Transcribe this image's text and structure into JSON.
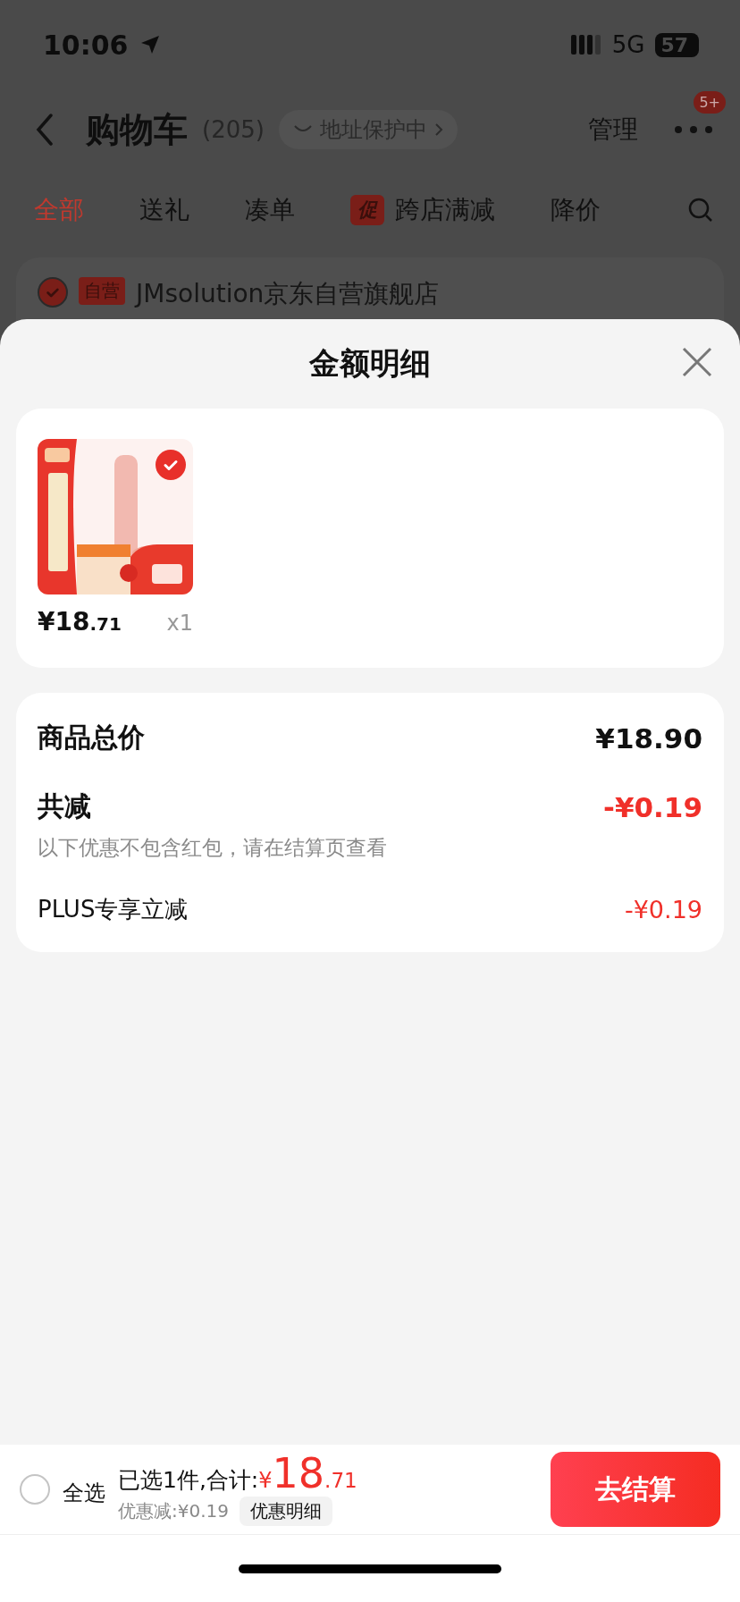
{
  "status_bar": {
    "time": "10:06",
    "network": "5G",
    "battery": "57"
  },
  "nav": {
    "title": "购物车",
    "count": "(205)",
    "address": "地址保护中",
    "manage": "管理",
    "badge": "5+"
  },
  "tabs": [
    {
      "label": "全部",
      "selected": true
    },
    {
      "label": "送礼",
      "selected": false
    },
    {
      "label": "凑单",
      "selected": false
    },
    {
      "label": "跨店满减",
      "selected": false,
      "tag": "促"
    },
    {
      "label": "降价",
      "selected": false
    }
  ],
  "store": {
    "checked": true,
    "tag": "自营",
    "name": "JMsolution京东自营旗舰店"
  },
  "sheet": {
    "title": "金额明细",
    "products": [
      {
        "kind": "picture",
        "checked": true,
        "price_main": "¥18",
        "price_decimal": ".71",
        "quantity": "x1"
      }
    ],
    "summary": [
      {
        "kind": "total",
        "label": "商品总价",
        "value": "¥18.90"
      },
      {
        "kind": "discount",
        "label": "共减",
        "value": "-¥0.19",
        "note": "以下优惠不包含红包，请在结算页查看"
      },
      {
        "kind": "item",
        "label": "PLUS专享立减",
        "value": "-¥0.19"
      }
    ]
  },
  "footer": {
    "select_all": {
      "label": "全选",
      "checked": false
    },
    "selected_text": "已选1件,合计:",
    "currency": "¥",
    "total_main": "18",
    "total_decimal": ".71",
    "discount": "优惠减:¥0.19",
    "detail_button": "优惠明细",
    "checkout": "去结算"
  }
}
